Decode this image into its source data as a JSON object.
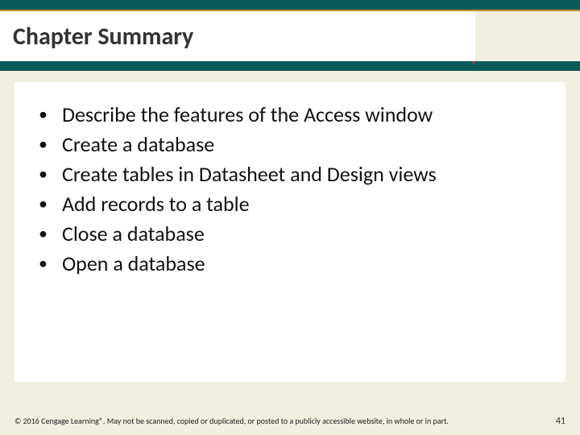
{
  "header": {
    "title": "Chapter Summary"
  },
  "bullets": [
    "Describe the features of the Access window",
    "Create a database",
    "Create tables in Datasheet and Design views",
    "Add records to a table",
    "Close a database",
    "Open a database"
  ],
  "footer": {
    "copyright": "© 2016 Cengage Learning®. May not be scanned, copied or duplicated, or posted to a publicly accessible website, in whole or in part.",
    "page": "41"
  }
}
